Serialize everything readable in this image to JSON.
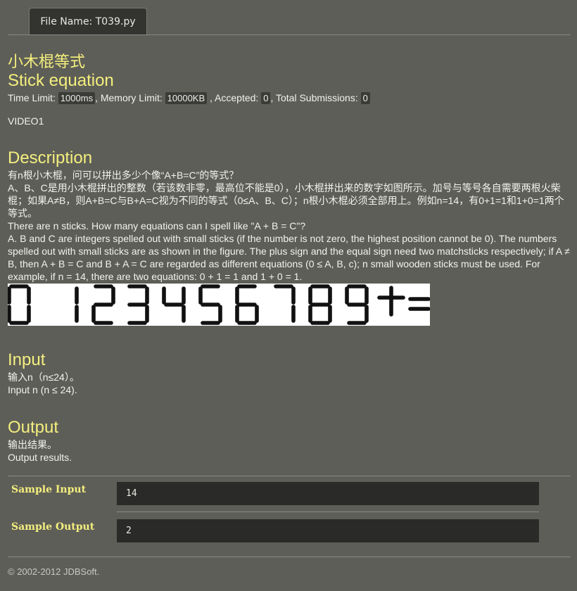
{
  "tab": {
    "label": "File Name:  T039.py"
  },
  "title_cn": "小木棍等式",
  "title_en": "Stick equation",
  "meta": {
    "time_limit_label": "Time Limit:",
    "time_limit_value": "1000ms",
    "memory_limit_label": ", Memory Limit:",
    "memory_limit_value": "10000KB",
    "accepted_label": ", Accepted:",
    "accepted_value": "0",
    "submissions_label": ", Total Submissions:",
    "submissions_value": "0"
  },
  "video": "VIDEO1",
  "description": {
    "heading": "Description",
    "cn_line1": "有n根小木棍，问可以拼出多少个像“A+B=C”的等式？",
    "cn_line2": "A、B、C是用小木棍拼出的整数（若该数非零，最高位不能是0），小木棍拼出来的数字如图所示。加号与等号各自需要两根火柴棍；如果A≠B，则A+B=C与B+A=C视为不同的等式（0≤A、B、C）；n根小木棍必须全部用上。例如n=14，有0+1=1和1+0=1两个等式。",
    "en_line1": "There are n sticks. How many equations can I spell like \"A + B = C\"?",
    "en_line2": "A. B and C are integers spelled out with small sticks (if the number is not zero, the highest position cannot be 0). The numbers spelled out with small sticks are as shown in the figure. The plus sign and the equal sign need two matchsticks respectively; if A ≠ B, then A + B = C and B + A = C are regarded as different equations (0 ≤ A, B, c); n small wooden sticks must be used. For example, if n = 14, there are two equations: 0 + 1 = 1 and 1 + 0 = 1."
  },
  "figure": {
    "glyphs": [
      "0",
      "1",
      "2",
      "3",
      "4",
      "5",
      "6",
      "7",
      "8",
      "9",
      "+",
      "="
    ]
  },
  "input": {
    "heading": "Input",
    "cn": "输入n（n≤24）。",
    "en": "Input n (n ≤ 24)."
  },
  "output": {
    "heading": "Output",
    "cn": "输出结果。",
    "en": "Output results."
  },
  "sample": {
    "input_label": "Sample Input",
    "input_value": "14",
    "output_label": "Sample Output",
    "output_value": "2"
  },
  "footer": "© 2002-2012  JDBSoft."
}
